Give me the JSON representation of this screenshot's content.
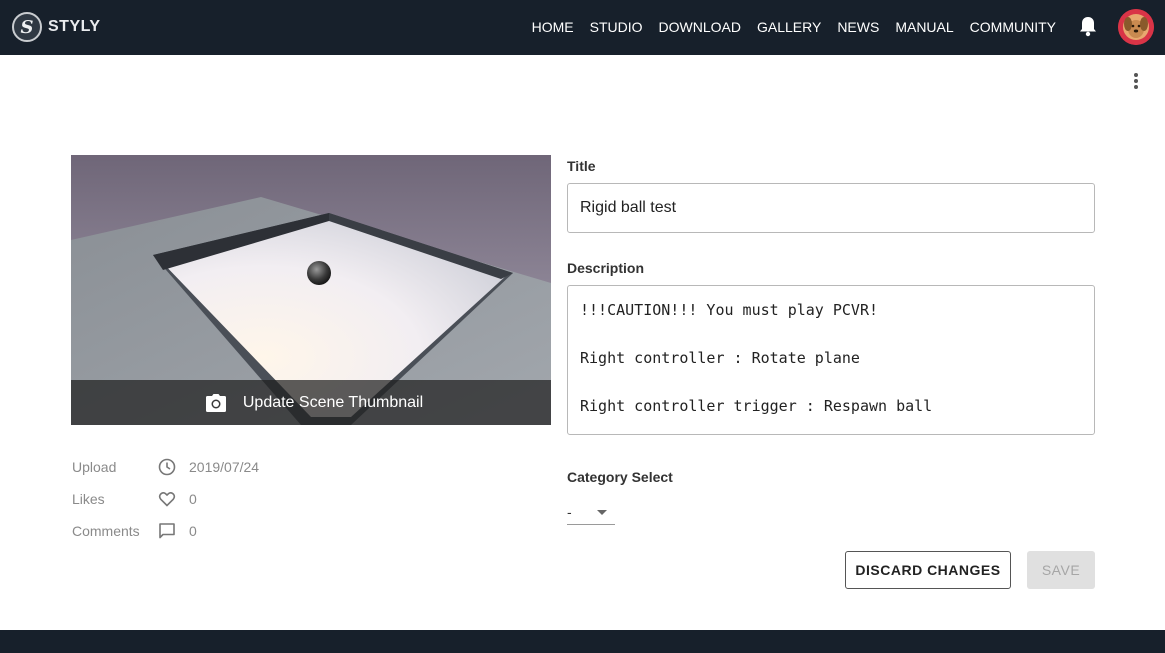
{
  "header": {
    "logo_letter": "S",
    "logo_text": "STYLY",
    "nav": [
      "HOME",
      "STUDIO",
      "DOWNLOAD",
      "GALLERY",
      "NEWS",
      "MANUAL",
      "COMMUNITY"
    ]
  },
  "thumbnail": {
    "update_label": "Update Scene Thumbnail"
  },
  "stats": {
    "upload_label": "Upload",
    "upload_value": "2019/07/24",
    "likes_label": "Likes",
    "likes_value": "0",
    "comments_label": "Comments",
    "comments_value": "0"
  },
  "form": {
    "title_label": "Title",
    "title_value": "Rigid ball test",
    "description_label": "Description",
    "description_lines": [
      "!!!CAUTION!!! You must play PCVR!",
      "",
      "Right controller : Rotate plane",
      "",
      "Right controller trigger : Respawn ball"
    ],
    "category_label": "Category Select",
    "category_value": "-",
    "discard_label": "DISCARD CHANGES",
    "save_label": "SAVE"
  },
  "colors": {
    "topbar": "#17202b",
    "save_disabled_bg": "#e0e0e0",
    "save_disabled_text": "#a6a6a6"
  },
  "icons": [
    "bell-icon",
    "more-vert-icon",
    "camera-icon",
    "clock-icon",
    "heart-icon",
    "comment-icon",
    "caret-down-icon"
  ]
}
